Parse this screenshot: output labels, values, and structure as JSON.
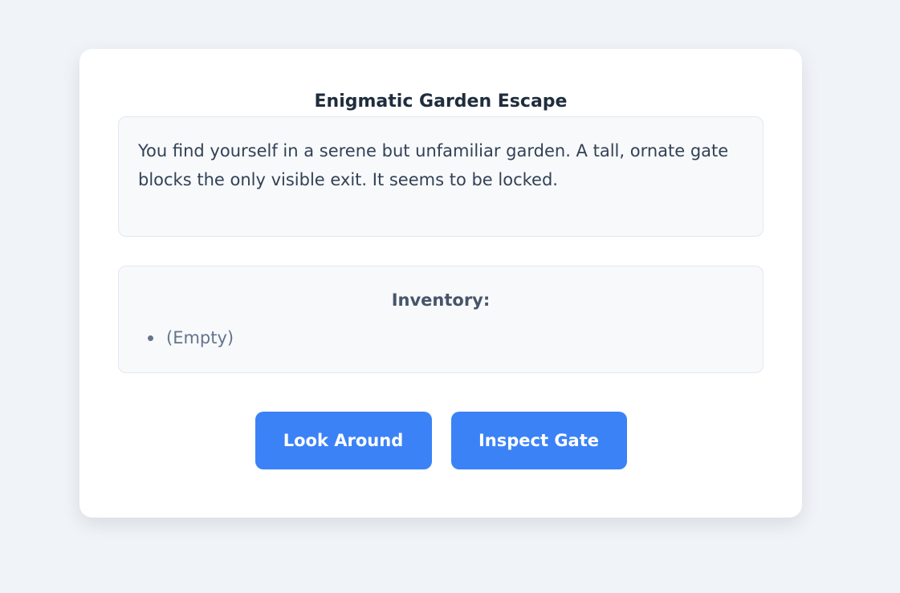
{
  "game": {
    "title": "Enigmatic Garden Escape",
    "story_text": "You find yourself in a serene but unfamiliar garden. A tall, ornate gate blocks the only visible exit. It seems to be locked.",
    "inventory": {
      "heading": "Inventory:",
      "items": [
        "(Empty)"
      ]
    },
    "actions": [
      {
        "label": "Look Around"
      },
      {
        "label": "Inspect Gate"
      }
    ]
  },
  "colors": {
    "background": "#f0f4f8",
    "card": "#ffffff",
    "panel": "#f7f9fb",
    "accent": "#3b82f6"
  }
}
